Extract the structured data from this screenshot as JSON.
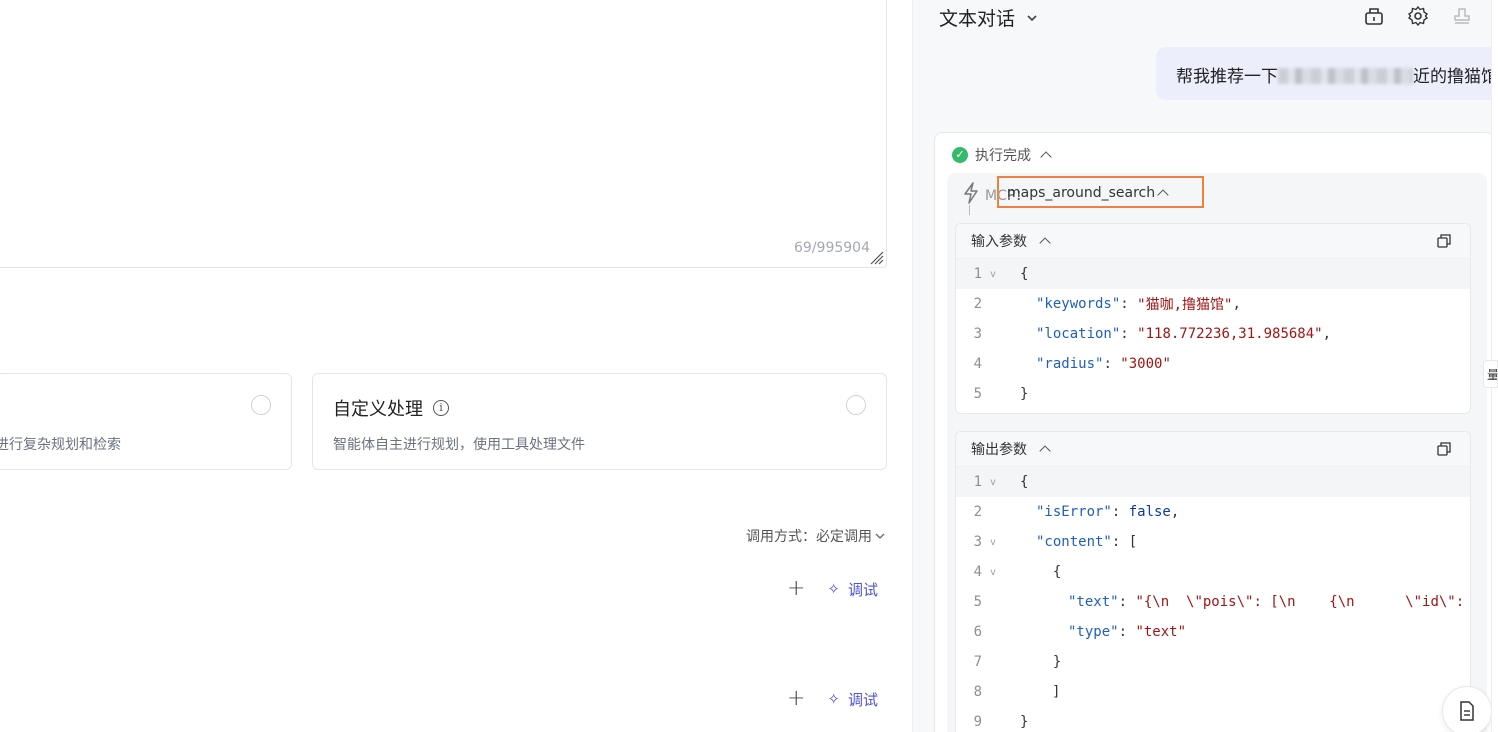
{
  "editor": {
    "counter": "69/995904"
  },
  "cards": [
    {
      "title": "",
      "desc": "进行复杂规划和检索"
    },
    {
      "title": "自定义处理",
      "desc": "智能体自主进行规划，使用工具处理文件"
    }
  ],
  "call_mode": {
    "label": "调用方式：必定调用"
  },
  "actions": [
    {
      "plus": "+",
      "debug": "调试"
    },
    {
      "plus": "+",
      "debug": "调试"
    }
  ],
  "right": {
    "title": "文本对话",
    "user_msg": {
      "before": "帮我推荐一下",
      "after": "近的撸猫馆"
    },
    "status": "执行完成",
    "mcp": {
      "prefix": "MCP：",
      "mc": "MC",
      "p": "P：",
      "name": "maps_around_search"
    },
    "input_panel": {
      "title": "输入参数",
      "lines": [
        {
          "n": "1",
          "fold": "v",
          "text": "{"
        },
        {
          "n": "2",
          "key": "\"keywords\"",
          "val": "\"猫咖,撸猫馆\"",
          "tail": ","
        },
        {
          "n": "3",
          "key": "\"location\"",
          "val": "\"118.772236,31.985684\"",
          "tail": ","
        },
        {
          "n": "4",
          "key": "\"radius\"",
          "val": "\"3000\"",
          "tail": ""
        },
        {
          "n": "5",
          "text": "}"
        }
      ]
    },
    "output_panel": {
      "title": "输出参数",
      "lines": [
        {
          "n": "1",
          "fold": "v",
          "text": "{"
        },
        {
          "n": "2",
          "key": "\"isError\"",
          "bool": "false",
          "tail": ","
        },
        {
          "n": "3",
          "fold": "v",
          "key": "\"content\"",
          "tail": ": ["
        },
        {
          "n": "4",
          "fold": "v",
          "text": "  {"
        },
        {
          "n": "5",
          "key": "\"text\"",
          "val": "\"{\\n  \\\"pois\\\": [\\n    {\\n      \\\"id\\\":"
        },
        {
          "n": "6",
          "key": "\"type\"",
          "val": "\"text\""
        },
        {
          "n": "7",
          "text": "  }"
        },
        {
          "n": "8",
          "text": "]"
        },
        {
          "n": "9",
          "text": "}"
        }
      ]
    },
    "edge_tab": "量"
  },
  "colors": {
    "accent": "#4f55d8",
    "success": "#35b96b",
    "highlight": "#f0803c",
    "bubble": "#eceefc"
  }
}
